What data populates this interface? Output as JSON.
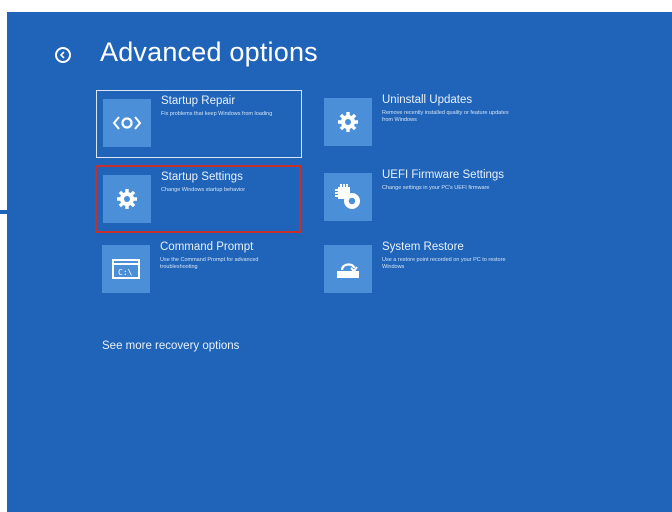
{
  "page": {
    "title": "Advanced options",
    "more_link": "See more recovery options"
  },
  "colors": {
    "background": "#1f64b8",
    "icon_box": "#4a8fd8",
    "highlight_border": "#c4302b"
  },
  "tiles": [
    {
      "title": "Startup Repair",
      "description": "Fix problems that keep Windows from loading",
      "icon": "startup-repair-icon",
      "state": "focused"
    },
    {
      "title": "Uninstall Updates",
      "description": "Remove recently installed quality or feature updates from Windows",
      "icon": "gear-icon",
      "state": "normal"
    },
    {
      "title": "Startup Settings",
      "description": "Change Windows startup behavior",
      "icon": "gear-icon",
      "state": "highlighted"
    },
    {
      "title": "UEFI Firmware Settings",
      "description": "Change settings in your PC's UEFI firmware",
      "icon": "firmware-settings-icon",
      "state": "normal"
    },
    {
      "title": "Command Prompt",
      "description": "Use the Command Prompt for advanced troubleshooting",
      "icon": "command-prompt-icon",
      "state": "normal"
    },
    {
      "title": "System Restore",
      "description": "Use a restore point recorded on your PC to restore Windows",
      "icon": "system-restore-icon",
      "state": "normal"
    }
  ]
}
